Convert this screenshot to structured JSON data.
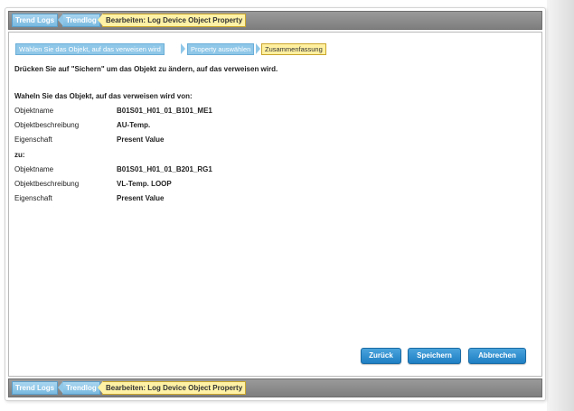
{
  "breadcrumb": {
    "items": [
      {
        "label": "Trend Logs"
      },
      {
        "label": "Trendlog"
      },
      {
        "label": "Bearbeiten: Log Device Object Property"
      }
    ]
  },
  "wizard": {
    "steps": [
      {
        "label": "Wählen Sie das Objekt, auf das verweisen wird"
      },
      {
        "label": "Property auswählen"
      },
      {
        "label": "Zusammenfassung"
      }
    ]
  },
  "content": {
    "instruction": "Drücken Sie auf \"Sichern\" um das Objekt zu ändern, auf das verweisen wird.",
    "from_heading": "Waheln Sie das Objekt, auf das verweisen wird von:",
    "from": {
      "objektname_label": "Objektname",
      "objektname_value": "B01S01_H01_01_B101_ME1",
      "beschreibung_label": "Objektbeschreibung",
      "beschreibung_value": "AU-Temp.",
      "eigenschaft_label": "Eigenschaft",
      "eigenschaft_value": "Present Value"
    },
    "to_heading": "zu:",
    "to": {
      "objektname_label": "Objektname",
      "objektname_value": "B01S01_H01_01_B201_RG1",
      "beschreibung_label": "Objektbeschreibung",
      "beschreibung_value": "VL-Temp. LOOP",
      "eigenschaft_label": "Eigenschaft",
      "eigenschaft_value": "Present Value"
    }
  },
  "buttons": {
    "back": "Zurück",
    "save": "Speichern",
    "cancel": "Abbrechen"
  },
  "colors": {
    "button_blue": "#1e7fc3",
    "breadcrumb_link": "#8fc7e8",
    "breadcrumb_current": "#fff2a6",
    "bar_gray": "#8a8a8a"
  }
}
